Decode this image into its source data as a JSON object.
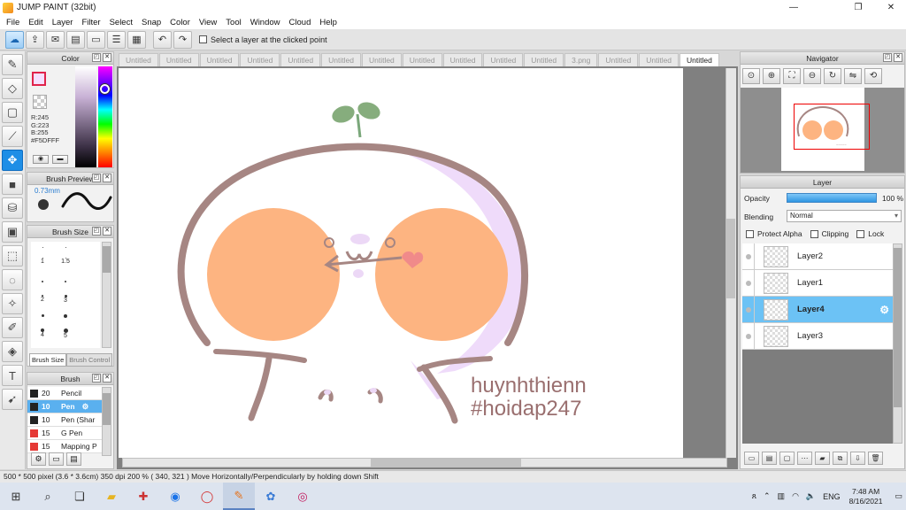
{
  "window": {
    "title": "JUMP PAINT (32bit)",
    "controls": [
      "—",
      "❐",
      "✕"
    ]
  },
  "menu": [
    "File",
    "Edit",
    "Layer",
    "Filter",
    "Select",
    "Snap",
    "Color",
    "View",
    "Tool",
    "Window",
    "Cloud",
    "Help"
  ],
  "toolbar": {
    "select_layer_label": "Select a layer at the clicked point"
  },
  "doc_tabs": [
    "Untitled",
    "Untitled",
    "Untitled",
    "Untitled",
    "Untitled",
    "Untitled",
    "Untitled",
    "Untitled",
    "Untitled",
    "Untitled",
    "Untitled",
    "3.png",
    "Untitled",
    "Untitled",
    "Untitled"
  ],
  "active_doc_tab": 14,
  "color_panel": {
    "title": "Color",
    "r": "R:245",
    "g": "G:223",
    "b": "B:255",
    "hex": "#F5DFFF",
    "current_color": "#F5DFFF"
  },
  "brush_preview": {
    "title": "Brush Preview",
    "size": "0.73mm"
  },
  "brush_size": {
    "title": "Brush Size",
    "labels": [
      "1",
      "1.5",
      "2",
      "3",
      "4",
      "5"
    ],
    "tab_size": "Brush Size",
    "tab_control": "Brush Control"
  },
  "brush_list": {
    "title": "Brush",
    "items": [
      {
        "size": "20",
        "name": "Pencil",
        "color": "#222222"
      },
      {
        "size": "10",
        "name": "Pen",
        "color": "#222222"
      },
      {
        "size": "10",
        "name": "Pen (Shar",
        "color": "#222222"
      },
      {
        "size": "15",
        "name": "G Pen",
        "color": "#e53935"
      },
      {
        "size": "15",
        "name": "Mapping P",
        "color": "#e53935"
      }
    ],
    "selected_index": 1
  },
  "navigator": {
    "title": "Navigator"
  },
  "layer_panel": {
    "title": "Layer",
    "opacity_label": "Opacity",
    "opacity_value": "100 %",
    "blending_label": "Blending",
    "blending_value": "Normal",
    "protect_alpha": "Protect Alpha",
    "clipping": "Clipping",
    "lock": "Lock",
    "layers": [
      "Layer2",
      "Layer1",
      "Layer4",
      "Layer3"
    ],
    "selected_index": 2
  },
  "artwork": {
    "watermark_line1": "huynhthienn",
    "watermark_line2": "#hoidap247"
  },
  "status": {
    "text": "500 * 500 pixel   (3.6 * 3.6cm)   350 dpi   200 %   ( 340, 321 )   Move Horizontally/Perpendicularly by holding down Shift"
  },
  "taskbar": {
    "lang": "ENG",
    "time": "7:48 AM",
    "date": "8/16/2021"
  }
}
